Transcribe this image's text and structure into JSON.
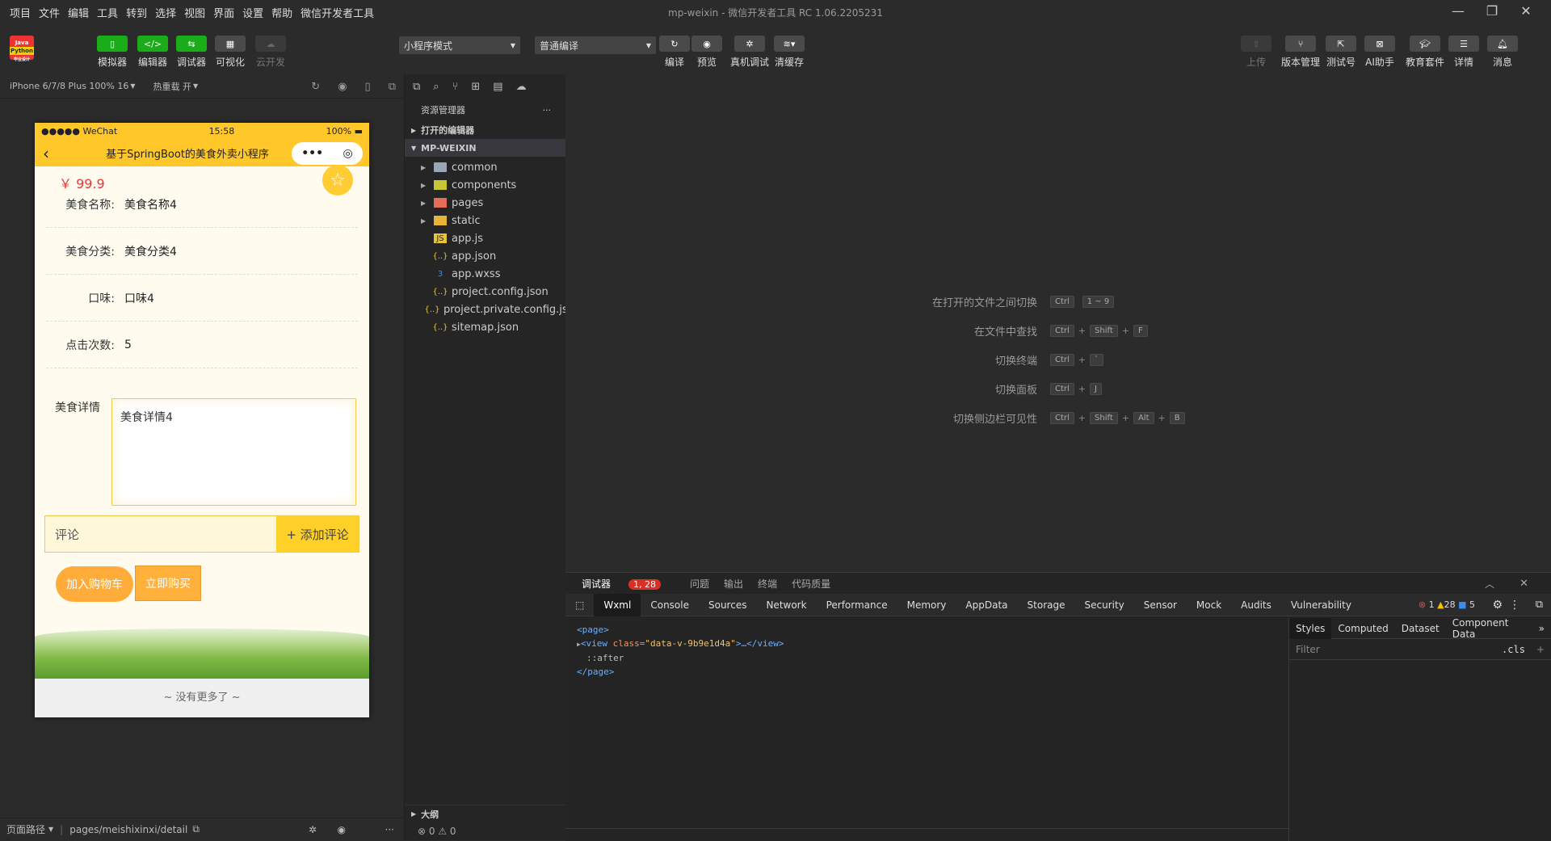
{
  "menu": [
    "项目",
    "文件",
    "编辑",
    "工具",
    "转到",
    "选择",
    "视图",
    "界面",
    "设置",
    "帮助",
    "微信开发者工具"
  ],
  "window": {
    "title": "mp-weixin - 微信开发者工具 RC 1.06.2205231"
  },
  "logo": {
    "line1": "Java",
    "line2": "Python",
    "line3": "毕业设计"
  },
  "toolbar": {
    "simulator": "模拟器",
    "editor": "编辑器",
    "debugger": "调试器",
    "visual": "可视化",
    "cloud": "云开发",
    "mode_select": "小程序模式",
    "compile_select": "普通编译",
    "compile": "编译",
    "preview": "预览",
    "remote_debug": "真机调试",
    "clear_cache": "清缓存",
    "upload": "上传",
    "version": "版本管理",
    "test_no": "测试号",
    "ai": "AI助手",
    "edu": "教育套件",
    "details": "详情",
    "messages": "消息"
  },
  "simhead": {
    "device": "iPhone 6/7/8 Plus 100% 16",
    "hot_reload": "热重载 开"
  },
  "phone": {
    "carrier": "●●●●● WeChat",
    "time": "15:58",
    "battery": "100%",
    "nav_title": "基于SpringBoot的美食外卖小程序",
    "price": "￥ 99.9",
    "fields": [
      {
        "key": "美食名称:",
        "value": "美食名称4"
      },
      {
        "key": "美食分类:",
        "value": "美食分类4"
      },
      {
        "key": "口味:",
        "value": "口味4"
      },
      {
        "key": "点击次数:",
        "value": "5"
      }
    ],
    "detail_label": "美食详情",
    "detail_value": "美食详情4",
    "comment_placeholder": "评论",
    "add_comment": "+ 添加评论",
    "add_cart": "加入购物车",
    "buy_now": "立即购买",
    "no_more": "~ 没有更多了 ~"
  },
  "simfoot": {
    "path_label": "页面路径",
    "path": "pages/meishixinxi/detail"
  },
  "explorer": {
    "title": "资源管理器",
    "open_editors": "打开的编辑器",
    "project": "MP-WEIXIN",
    "items": [
      "common",
      "components",
      "pages",
      "static",
      "app.js",
      "app.json",
      "app.wxss",
      "project.config.json",
      "project.private.config.js...",
      "sitemap.json"
    ],
    "outline": "大纲",
    "status": "⊗ 0 ⚠ 0"
  },
  "shortcuts": [
    {
      "label": "在打开的文件之间切换",
      "keys": [
        "Ctrl",
        "1 ~ 9"
      ]
    },
    {
      "label": "在文件中查找",
      "keys": [
        "Ctrl",
        "Shift",
        "F"
      ]
    },
    {
      "label": "切换终端",
      "keys": [
        "Ctrl",
        "`"
      ]
    },
    {
      "label": "切换面板",
      "keys": [
        "Ctrl",
        "J"
      ]
    },
    {
      "label": "切换侧边栏可见性",
      "keys": [
        "Ctrl",
        "Shift",
        "Alt",
        "B"
      ]
    }
  ],
  "devtools": {
    "tabs_top": [
      "调试器",
      "问题",
      "输出",
      "终端",
      "代码质量"
    ],
    "debugger_badge": "1, 28",
    "tabs": [
      "Wxml",
      "Console",
      "Sources",
      "Network",
      "Performance",
      "Memory",
      "AppData",
      "Storage",
      "Security",
      "Sensor",
      "Mock",
      "Audits",
      "Vulnerability"
    ],
    "err_count": "1",
    "warn_count": "28",
    "info_count": "5",
    "dom_page_open": "<page>",
    "dom_view_tag": "view",
    "dom_view_attr": "class",
    "dom_view_value": "\"data-v-9b9e1d4a\"",
    "dom_view_rest": ">…</view>",
    "dom_after": "::after",
    "dom_page_close": "</page>",
    "style_tabs": [
      "Styles",
      "Computed",
      "Dataset",
      "Component Data"
    ],
    "filter": "Filter",
    "cls": ".cls"
  }
}
